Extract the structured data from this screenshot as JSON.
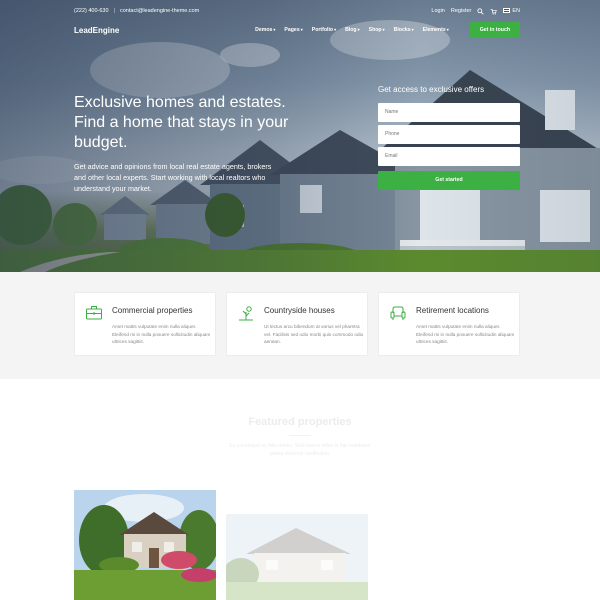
{
  "topbar": {
    "phone": "(222) 400-630",
    "email": "contact@leadengine-theme.com",
    "login": "Login",
    "register": "Register",
    "language": "EN"
  },
  "navbar": {
    "logo": "LeadEngine",
    "items": [
      "Demos",
      "Pages",
      "Portfolio",
      "Blog",
      "Shop",
      "Blocks",
      "Elements"
    ],
    "cta": "Get in touch"
  },
  "hero": {
    "title": "Exclusive homes and estates. Find a home that stays in your budget.",
    "subtitle": "Get advice and opinions from local real estate agents, brokers and other local experts. Start working with local realtors who understand your market."
  },
  "form": {
    "title": "Get access to exclusive offers",
    "name_placeholder": "Name",
    "phone_placeholder": "Phone",
    "email_placeholder": "Email",
    "submit": "Get started"
  },
  "features": [
    {
      "title": "Commercial properties",
      "text": "Amet mattis vulputate enim nulla aliquet. Eleifend mi in nulla posuere sollicitudin aliquam ultrices sagittis.",
      "icon": "briefcase-icon"
    },
    {
      "title": "Countryside houses",
      "text": "Ut lectus arcu bibendum at varius vel pharetra vel. Facilisis sed odio morbi quis commodo odio aenean.",
      "icon": "countryside-icon"
    },
    {
      "title": "Retirement locations",
      "text": "Amet mattis vulputate enim nulla aliquet. Eleifend mi in nulla posuere sollicitudin aliquam ultrices sagittis.",
      "icon": "armchair-icon"
    }
  ],
  "featured": {
    "title": "Featured properties",
    "subtitle": "Eu consequat ac felis donec. Sed viverra tellus in hac habitasse platea dictumst vestibulum."
  },
  "colors": {
    "accent": "#3cb043",
    "features_bg": "#f4f4f4"
  }
}
